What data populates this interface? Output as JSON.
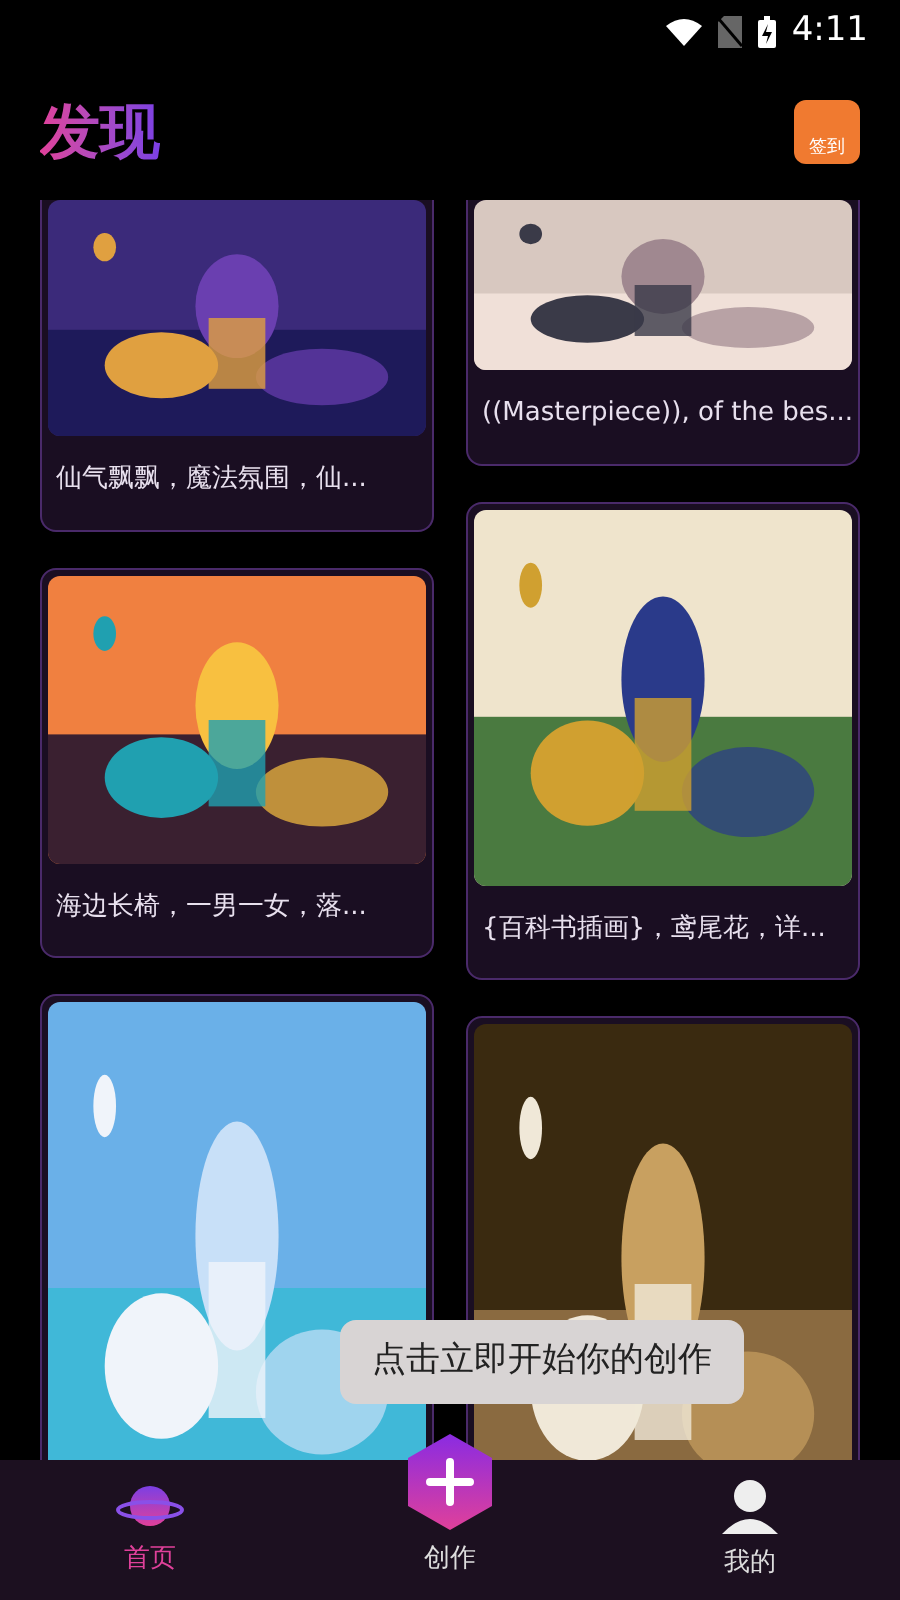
{
  "status_bar": {
    "time": "4:11"
  },
  "header": {
    "title": "发现",
    "checkin_label": "签到"
  },
  "columns": [
    [
      {
        "caption": "仙气飘飘，魔法氛围，仙..."
      },
      {
        "caption": "海边长椅，一男一女，落..."
      },
      {}
    ],
    [
      {
        "caption": "((Masterpiece)), of the bes..."
      },
      {
        "caption": "{百科书插画}，鸢尾花，详..."
      },
      {}
    ]
  ],
  "tooltip": "点击立即开始你的创作",
  "tabs": [
    {
      "kind": "home",
      "label": "首页",
      "selected": true
    },
    {
      "kind": "create",
      "label": "创作",
      "selected": false
    },
    {
      "kind": "mine",
      "label": "我的",
      "selected": false
    }
  ]
}
